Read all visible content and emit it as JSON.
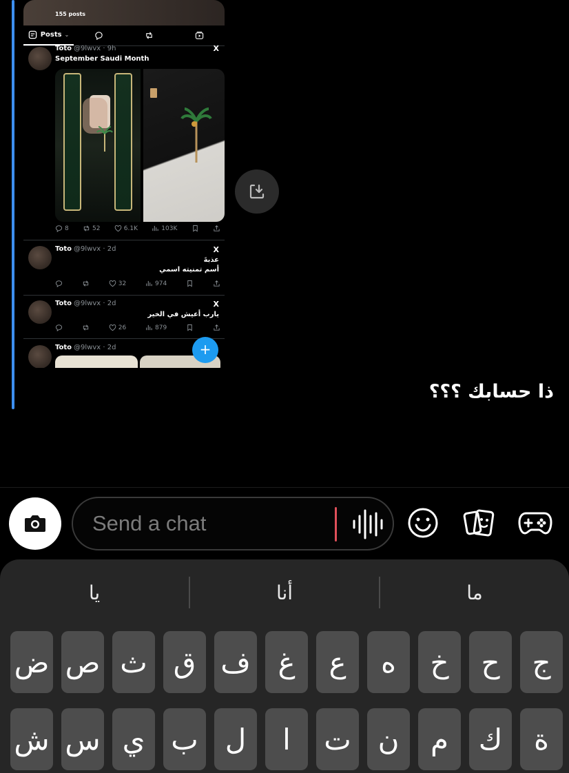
{
  "shared_post": {
    "profile": {
      "posts_count": "155 posts"
    },
    "tabs": [
      {
        "label": "Posts",
        "icon": "posts-icon"
      },
      {
        "label": "",
        "icon": "reply-icon"
      },
      {
        "label": "",
        "icon": "repost-icon"
      },
      {
        "label": "",
        "icon": "media-icon"
      }
    ],
    "tweets": [
      {
        "name": "Toto",
        "handle": "@9lwvx · 9h",
        "text": "September Saudi Month",
        "comments": "8",
        "reposts": "52",
        "likes": "6.1K",
        "views": "103K"
      },
      {
        "name": "Toto",
        "handle": "@9lwvx · 2d",
        "text_line1": "عذبةَ",
        "text_line2": "أسم تمنيته اسمي",
        "comments": "",
        "reposts": "",
        "likes": "32",
        "views": "974"
      },
      {
        "name": "Toto",
        "handle": "@9lwvx · 2d",
        "text": "يارب أعيش في الخير",
        "comments": "",
        "reposts": "",
        "likes": "26",
        "views": "879"
      },
      {
        "name": "Toto",
        "handle": "@9lwvx · 2d"
      }
    ],
    "fab_label": "+",
    "x_logo": "X"
  },
  "message": {
    "text": "ذا حسابك ؟؟؟"
  },
  "input_bar": {
    "placeholder": "Send a chat",
    "value": ""
  },
  "keyboard": {
    "suggestions": [
      "يا",
      "أنا",
      "ما"
    ],
    "row1": [
      "ج",
      "ح",
      "خ",
      "ه",
      "ع",
      "غ",
      "ف",
      "ق",
      "ث",
      "ص",
      "ض"
    ],
    "row2": [
      "ة",
      "ك",
      "م",
      "ن",
      "ت",
      "ا",
      "ل",
      "ب",
      "ي",
      "س",
      "ش"
    ]
  },
  "colors": {
    "reply_bar": "#3d8ff0",
    "fab": "#1d9bf0",
    "caret": "#e0505a",
    "keyboard_bg": "#262626",
    "key_bg": "#4d4d4d"
  }
}
